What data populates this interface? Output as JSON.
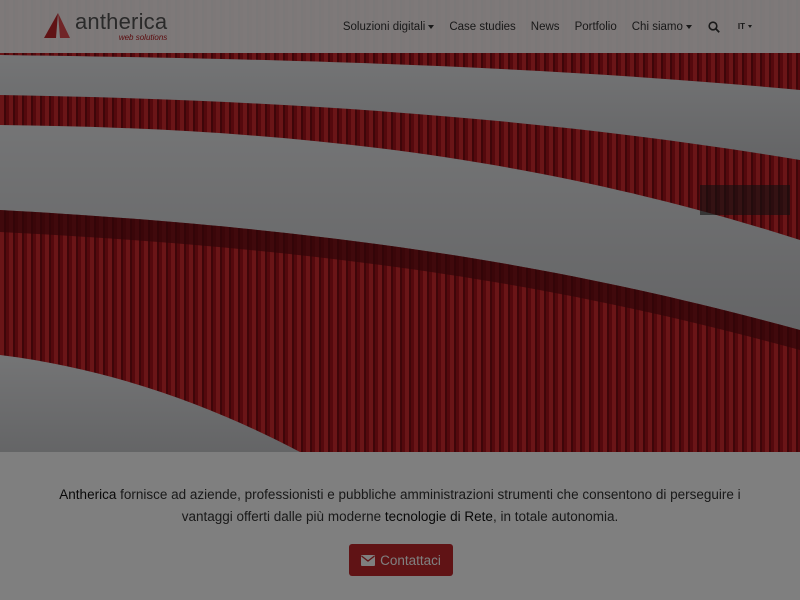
{
  "brand": {
    "name": "antherica",
    "tagline": "web solutions",
    "accent_color": "#b5161b"
  },
  "nav": {
    "items": [
      {
        "label": "Soluzioni digitali",
        "dropdown": true
      },
      {
        "label": "Case studies",
        "dropdown": false
      },
      {
        "label": "News",
        "dropdown": false
      },
      {
        "label": "Portfolio",
        "dropdown": false
      },
      {
        "label": "Chi siamo",
        "dropdown": true
      }
    ],
    "search_icon": "search-icon",
    "language": "IT"
  },
  "hero": {
    "image": "red corrugated metal facade with silver bands"
  },
  "intro": {
    "brand_link": "Antherica",
    "text_1": " fornisce ad aziende, professionisti e pubbliche amministrazioni strumenti che consentono di perseguire i vantaggi offerti dalle più moderne ",
    "tech_link": "tecnologie di Rete",
    "text_2": ", in totale autonomia."
  },
  "cta": {
    "label": "Contattaci",
    "icon": "envelope-icon",
    "color": "#c0262b"
  },
  "overlay": {
    "dimmed": true
  }
}
